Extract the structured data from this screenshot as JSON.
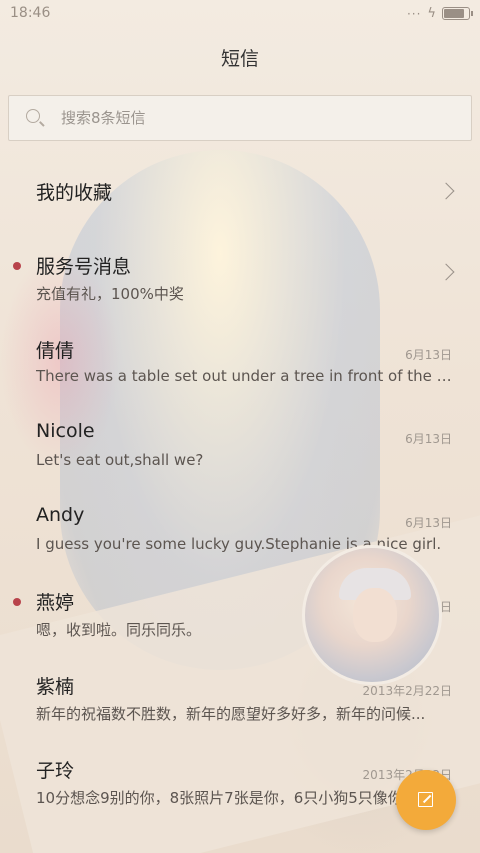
{
  "status": {
    "time": "18:46",
    "battery_fraction": 0.85
  },
  "header": {
    "title": "短信"
  },
  "search": {
    "placeholder": "搜索8条短信"
  },
  "items": [
    {
      "name": "我的收藏",
      "preview": "",
      "date": "",
      "chevron": true,
      "unread": false
    },
    {
      "name": "服务号消息",
      "preview": "充值有礼，100%中奖",
      "date": "",
      "chevron": true,
      "unread": true
    },
    {
      "name": "倩倩",
      "preview": "There was a table set out under a tree in front of the ho...",
      "date": "6月13日",
      "chevron": false,
      "unread": false
    },
    {
      "name": "Nicole",
      "preview": "Let's eat out,shall we?",
      "date": "6月13日",
      "chevron": false,
      "unread": false
    },
    {
      "name": "Andy",
      "preview": "I guess you're some lucky guy.Stephanie is a nice girl.",
      "date": "6月13日",
      "chevron": false,
      "unread": false
    },
    {
      "name": "燕婷",
      "preview": "嗯，收到啦。同乐同乐。",
      "date": "2013年2月22日",
      "chevron": false,
      "unread": true
    },
    {
      "name": "紫楠",
      "preview": "新年的祝福数不胜数，新年的愿望好多好多，新年的问候...",
      "date": "2013年2月22日",
      "chevron": false,
      "unread": false
    },
    {
      "name": "子玲",
      "preview": "10分想念9别的你，8张照片7张是你，6只小狗5只像你...",
      "date": "2013年2月22日",
      "chevron": false,
      "unread": false
    }
  ],
  "icons": {
    "search": "search-icon",
    "compose": "compose-icon",
    "chevron": "chevron-right-icon"
  },
  "colors": {
    "accent": "#f3aa3a",
    "unread_dot": "#b8434b"
  }
}
